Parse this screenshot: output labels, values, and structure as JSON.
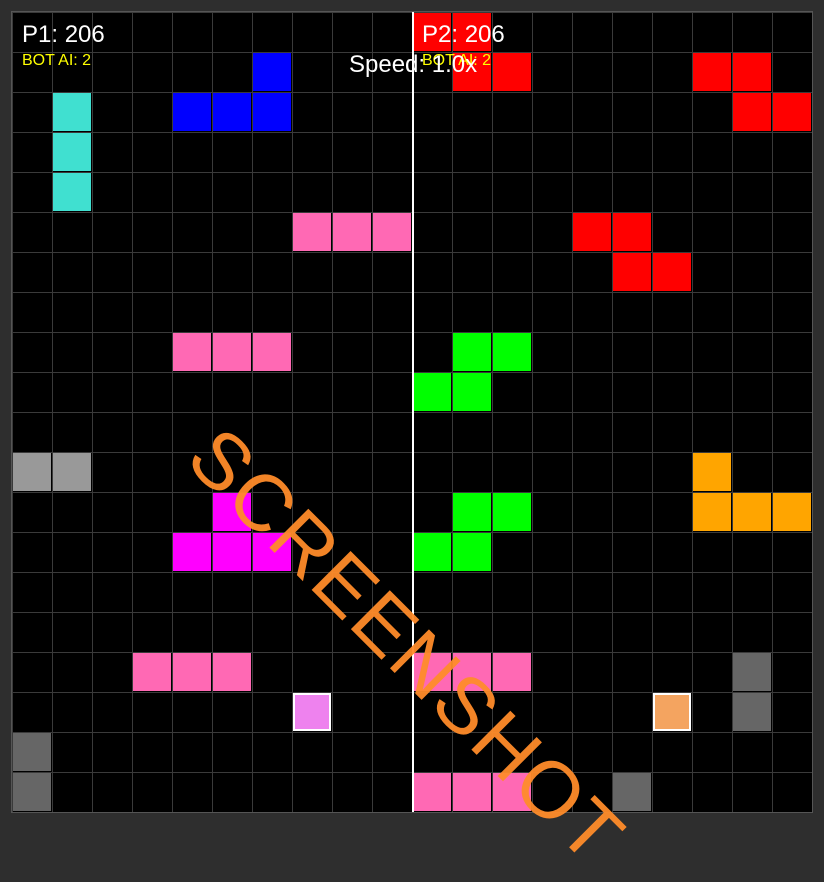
{
  "hud": {
    "p1_score": "P1: 206",
    "p1_ai": "BOT AI: 2",
    "p2_score": "P2: 206",
    "p2_ai": "BOT AI: 2",
    "speed": "Speed: 1.0x"
  },
  "watermark": "SCREENSHOT",
  "board": {
    "columns": 20,
    "rows": 20,
    "cells": [
      {
        "col": 10,
        "row": 0,
        "color": "#ff0000"
      },
      {
        "col": 11,
        "row": 0,
        "color": "#ff0000"
      },
      {
        "col": 11,
        "row": 1,
        "color": "#ff0000"
      },
      {
        "col": 12,
        "row": 1,
        "color": "#ff0000"
      },
      {
        "col": 6,
        "row": 1,
        "color": "#0000ff"
      },
      {
        "col": 4,
        "row": 2,
        "color": "#0000ff"
      },
      {
        "col": 5,
        "row": 2,
        "color": "#0000ff"
      },
      {
        "col": 6,
        "row": 2,
        "color": "#0000ff"
      },
      {
        "col": 17,
        "row": 1,
        "color": "#ff0000"
      },
      {
        "col": 18,
        "row": 1,
        "color": "#ff0000"
      },
      {
        "col": 18,
        "row": 2,
        "color": "#ff0000"
      },
      {
        "col": 19,
        "row": 2,
        "color": "#ff0000"
      },
      {
        "col": 1,
        "row": 2,
        "color": "#40e0d0"
      },
      {
        "col": 1,
        "row": 3,
        "color": "#40e0d0"
      },
      {
        "col": 1,
        "row": 4,
        "color": "#40e0d0"
      },
      {
        "col": 7,
        "row": 5,
        "color": "#ff69b4"
      },
      {
        "col": 8,
        "row": 5,
        "color": "#ff69b4"
      },
      {
        "col": 9,
        "row": 5,
        "color": "#ff69b4"
      },
      {
        "col": 14,
        "row": 5,
        "color": "#ff0000"
      },
      {
        "col": 15,
        "row": 5,
        "color": "#ff0000"
      },
      {
        "col": 15,
        "row": 6,
        "color": "#ff0000"
      },
      {
        "col": 16,
        "row": 6,
        "color": "#ff0000"
      },
      {
        "col": 4,
        "row": 8,
        "color": "#ff69b4"
      },
      {
        "col": 5,
        "row": 8,
        "color": "#ff69b4"
      },
      {
        "col": 6,
        "row": 8,
        "color": "#ff69b4"
      },
      {
        "col": 11,
        "row": 8,
        "color": "#00ff00"
      },
      {
        "col": 12,
        "row": 8,
        "color": "#00ff00"
      },
      {
        "col": 10,
        "row": 9,
        "color": "#00ff00"
      },
      {
        "col": 11,
        "row": 9,
        "color": "#00ff00"
      },
      {
        "col": 0,
        "row": 11,
        "color": "#999999"
      },
      {
        "col": 1,
        "row": 11,
        "color": "#999999"
      },
      {
        "col": 17,
        "row": 11,
        "color": "#ffa500"
      },
      {
        "col": 17,
        "row": 12,
        "color": "#ffa500"
      },
      {
        "col": 18,
        "row": 12,
        "color": "#ffa500"
      },
      {
        "col": 19,
        "row": 12,
        "color": "#ffa500"
      },
      {
        "col": 5,
        "row": 12,
        "color": "#ff00ff"
      },
      {
        "col": 4,
        "row": 13,
        "color": "#ff00ff"
      },
      {
        "col": 5,
        "row": 13,
        "color": "#ff00ff"
      },
      {
        "col": 6,
        "row": 13,
        "color": "#ff00ff"
      },
      {
        "col": 11,
        "row": 12,
        "color": "#00ff00"
      },
      {
        "col": 12,
        "row": 12,
        "color": "#00ff00"
      },
      {
        "col": 10,
        "row": 13,
        "color": "#00ff00"
      },
      {
        "col": 11,
        "row": 13,
        "color": "#00ff00"
      },
      {
        "col": 3,
        "row": 16,
        "color": "#ff69b4"
      },
      {
        "col": 4,
        "row": 16,
        "color": "#ff69b4"
      },
      {
        "col": 5,
        "row": 16,
        "color": "#ff69b4"
      },
      {
        "col": 10,
        "row": 16,
        "color": "#ff69b4"
      },
      {
        "col": 11,
        "row": 16,
        "color": "#ff69b4"
      },
      {
        "col": 12,
        "row": 16,
        "color": "#ff69b4"
      },
      {
        "col": 18,
        "row": 16,
        "color": "#666666"
      },
      {
        "col": 18,
        "row": 17,
        "color": "#666666"
      },
      {
        "col": 7,
        "row": 17,
        "color": "#ee82ee",
        "marker": true
      },
      {
        "col": 16,
        "row": 17,
        "color": "#f4a460",
        "marker": true
      },
      {
        "col": 0,
        "row": 18,
        "color": "#666666"
      },
      {
        "col": 0,
        "row": 19,
        "color": "#666666"
      },
      {
        "col": 10,
        "row": 19,
        "color": "#ff69b4"
      },
      {
        "col": 11,
        "row": 19,
        "color": "#ff69b4"
      },
      {
        "col": 12,
        "row": 19,
        "color": "#ff69b4"
      },
      {
        "col": 15,
        "row": 19,
        "color": "#666666"
      }
    ]
  }
}
